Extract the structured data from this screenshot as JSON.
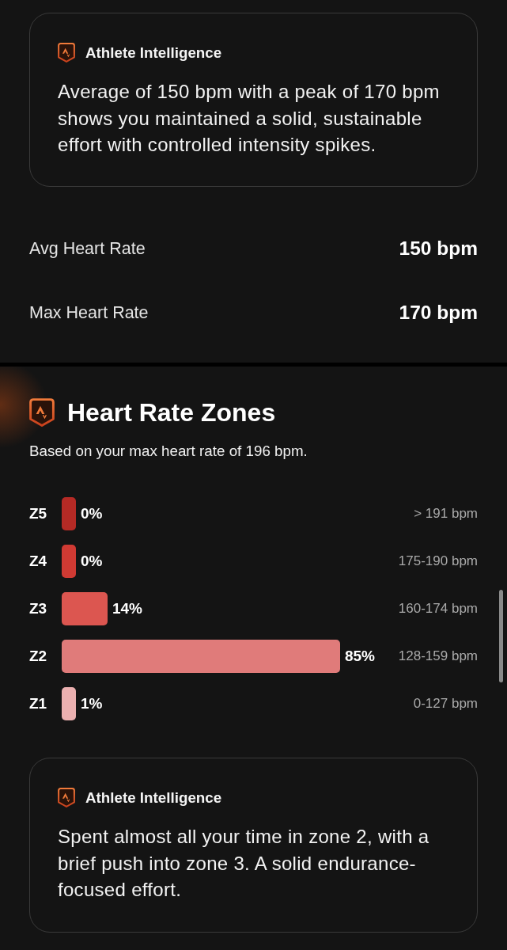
{
  "insight_card": {
    "title": "Athlete Intelligence",
    "text": "Average of 150 bpm with a peak of 170 bpm shows you maintained a solid, sustainable effort with controlled intensity spikes."
  },
  "stats": [
    {
      "label": "Avg Heart Rate",
      "value": "150 bpm"
    },
    {
      "label": "Max Heart Rate",
      "value": "170 bpm"
    }
  ],
  "zones_section": {
    "title": "Heart Rate Zones",
    "subtitle": "Based on your max heart rate of 196 bpm.",
    "zones": [
      {
        "label": "Z5",
        "percent": "0%",
        "range": "> 191 bpm",
        "level": 0,
        "color": "#b52a25"
      },
      {
        "label": "Z4",
        "percent": "0%",
        "range": "175-190 bpm",
        "level": 0,
        "color": "#d03a33"
      },
      {
        "label": "Z3",
        "percent": "14%",
        "range": "160-174 bpm",
        "level": 0.14,
        "color": "#dc5650"
      },
      {
        "label": "Z2",
        "percent": "85%",
        "range": "128-159 bpm",
        "level": 0.85,
        "color": "#e07b7a"
      },
      {
        "label": "Z1",
        "percent": "1%",
        "range": "0-127 bpm",
        "level": 0.01,
        "color": "#ebb0b0"
      }
    ]
  },
  "zones_insight_card": {
    "title": "Athlete Intelligence",
    "text": "Spent almost all your time in zone 2, with a brief push into zone 3. A solid endurance-focused effort."
  }
}
